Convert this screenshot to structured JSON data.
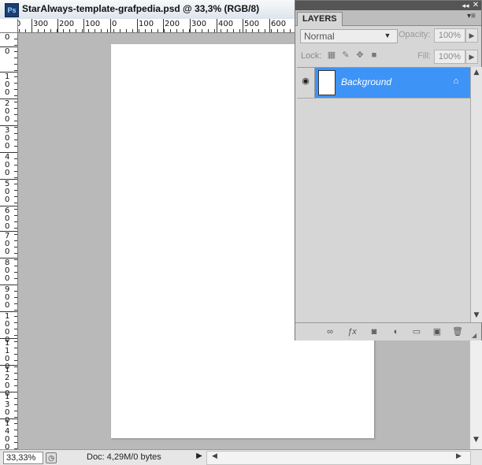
{
  "window": {
    "app_icon": "Ps",
    "title": "StarAlways-template-grafpedia.psd @ 33,3% (RGB/8)"
  },
  "rulers": {
    "horizontal_labels": [
      "0",
      "300",
      "200",
      "100",
      "0",
      "100",
      "200",
      "300",
      "400",
      "500",
      "600"
    ],
    "vertical_labels": [
      "0",
      "0",
      "1 0 0",
      "2 0 0",
      "3 0 0",
      "4 0 0",
      "5 0 0",
      "6 0 0",
      "7 0 0",
      "8 0 0",
      "9 0 0",
      "1 0 0 0",
      "1 1 0 0",
      "1 2 0 0",
      "1 3 0 0",
      "1 4 0 0"
    ]
  },
  "status_bar": {
    "zoom": "33,33%",
    "doc_info": "Doc: 4,29M/0 bytes"
  },
  "layers_panel": {
    "tab_label": "LAYERS",
    "blend_mode": "Normal",
    "opacity_label": "Opacity:",
    "opacity_value": "100%",
    "lock_label": "Lock:",
    "fill_label": "Fill:",
    "fill_value": "100%",
    "layers": [
      {
        "name": "Background",
        "visible": true,
        "locked": true,
        "selected": true
      }
    ],
    "bottom_icons": [
      "link-layers-icon",
      "fx-icon",
      "add-mask-icon",
      "adjustment-layer-icon",
      "new-group-icon",
      "new-layer-icon",
      "delete-layer-icon"
    ]
  },
  "colors": {
    "selected_layer": "#3d93f6",
    "canvas_background": "#b9b9b9",
    "panel_background": "#d6d6d6"
  }
}
